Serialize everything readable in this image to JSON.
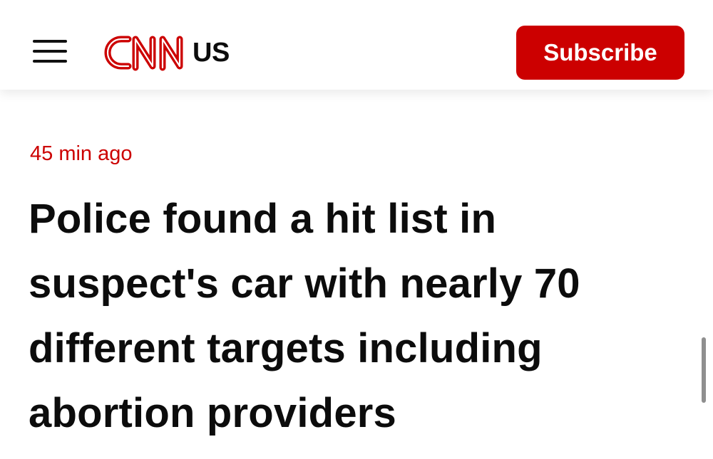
{
  "header": {
    "menu_icon": "hamburger-menu-icon",
    "logo_text": "CNN",
    "logo_color": "#cc0000",
    "edition": "US",
    "subscribe_label": "Subscribe",
    "subscribe_color": "#cc0000"
  },
  "article": {
    "timestamp": "45 min ago",
    "timestamp_color": "#cc0000",
    "headline": "Police found a hit list in suspect's car with nearly 70 different targets including abortion providers"
  }
}
